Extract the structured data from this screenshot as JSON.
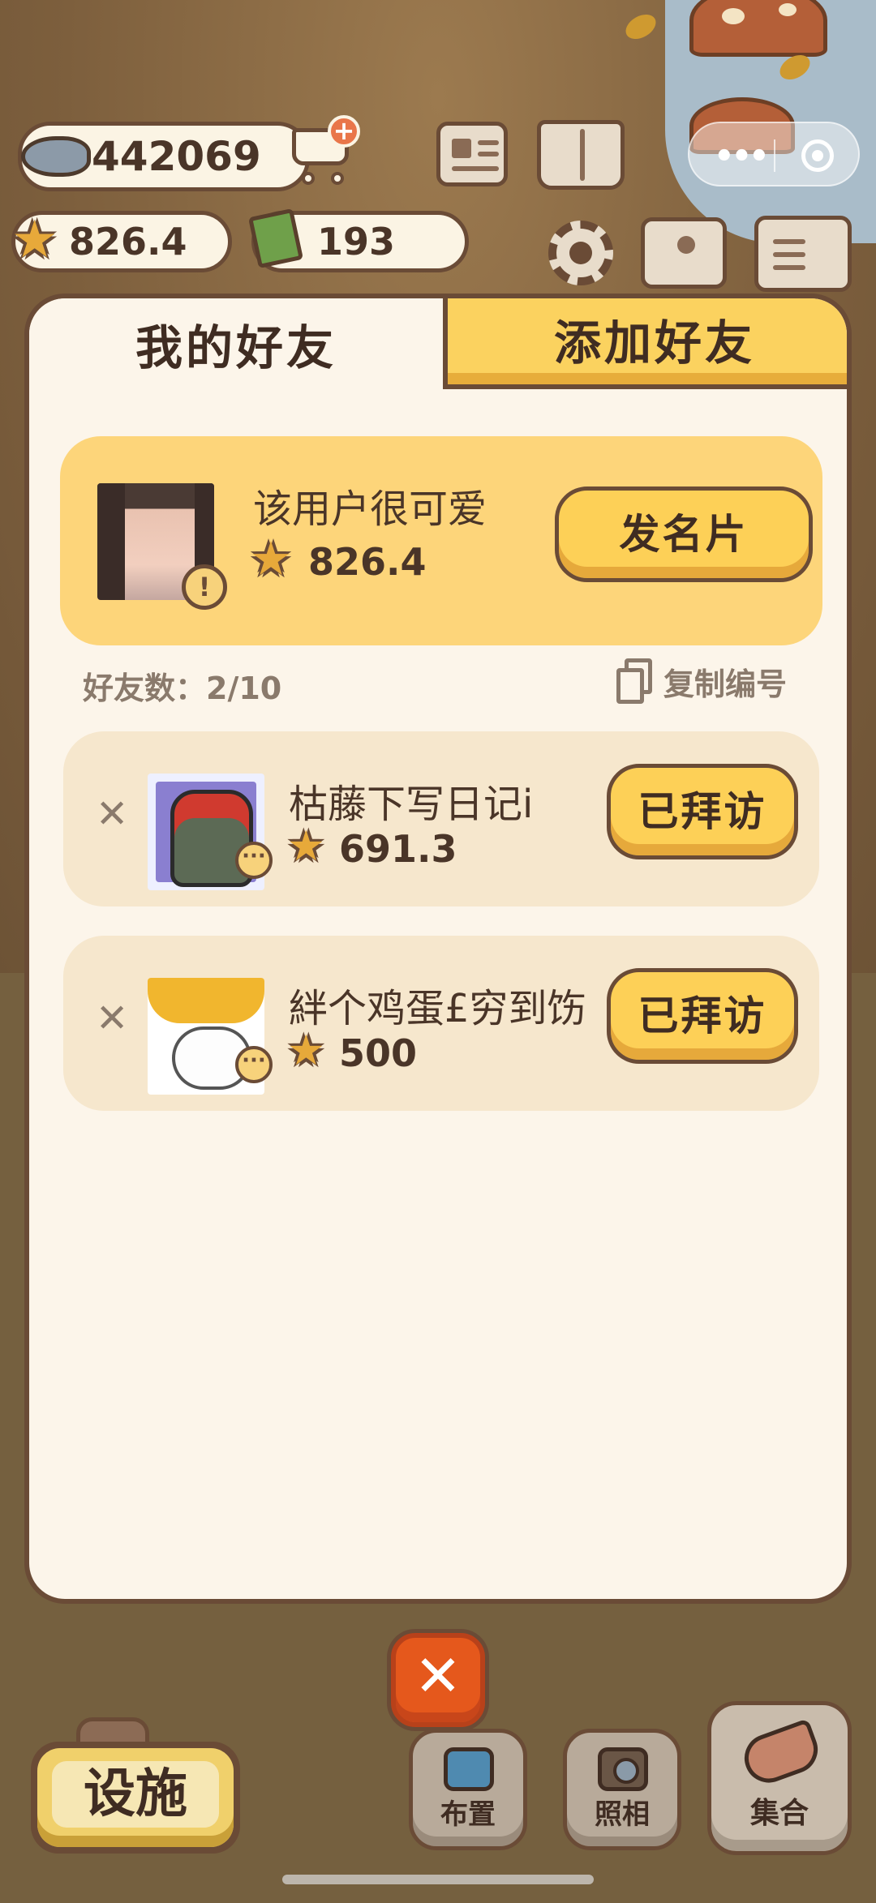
{
  "hud": {
    "fish_coins": "442069",
    "stars": "826.4",
    "tickets": "193"
  },
  "tabs": {
    "my_friends": "我的好友",
    "add_friend": "添加好友"
  },
  "me": {
    "name": "该用户很可爱",
    "score": "826.4",
    "send_card_label": "发名片"
  },
  "friend_count": "好友数：2/10",
  "copy_id_label": "复制编号",
  "friends": [
    {
      "name": "枯藤下写日记i",
      "score": "691.3",
      "status": "已拜访"
    },
    {
      "name": "絆个鸡蛋£穷到饬",
      "score": "500",
      "status": "已拜访"
    }
  ],
  "bottom": {
    "close_symbol": "✕",
    "facility_label": "设施",
    "layout_label": "布置",
    "photo_label": "照相",
    "gather_label": "集合"
  },
  "colors": {
    "panel_bg": "#fcf5ea",
    "border_brown": "#6a4b36",
    "button_yellow": "#fdd057",
    "close_orange": "#e5581c",
    "star_gold": "#e7a93a"
  },
  "icons": {
    "fish": "fish-icon",
    "cart": "shop-cart-plus-icon",
    "star": "star-icon",
    "ticket": "ticket-icon",
    "news": "news-icon",
    "book": "book-icon",
    "gear": "gear-icon",
    "map": "map-icon",
    "sort": "sort-icon",
    "copy": "copy-icon",
    "remove": "remove-x-icon",
    "more": "more-dots-icon"
  }
}
